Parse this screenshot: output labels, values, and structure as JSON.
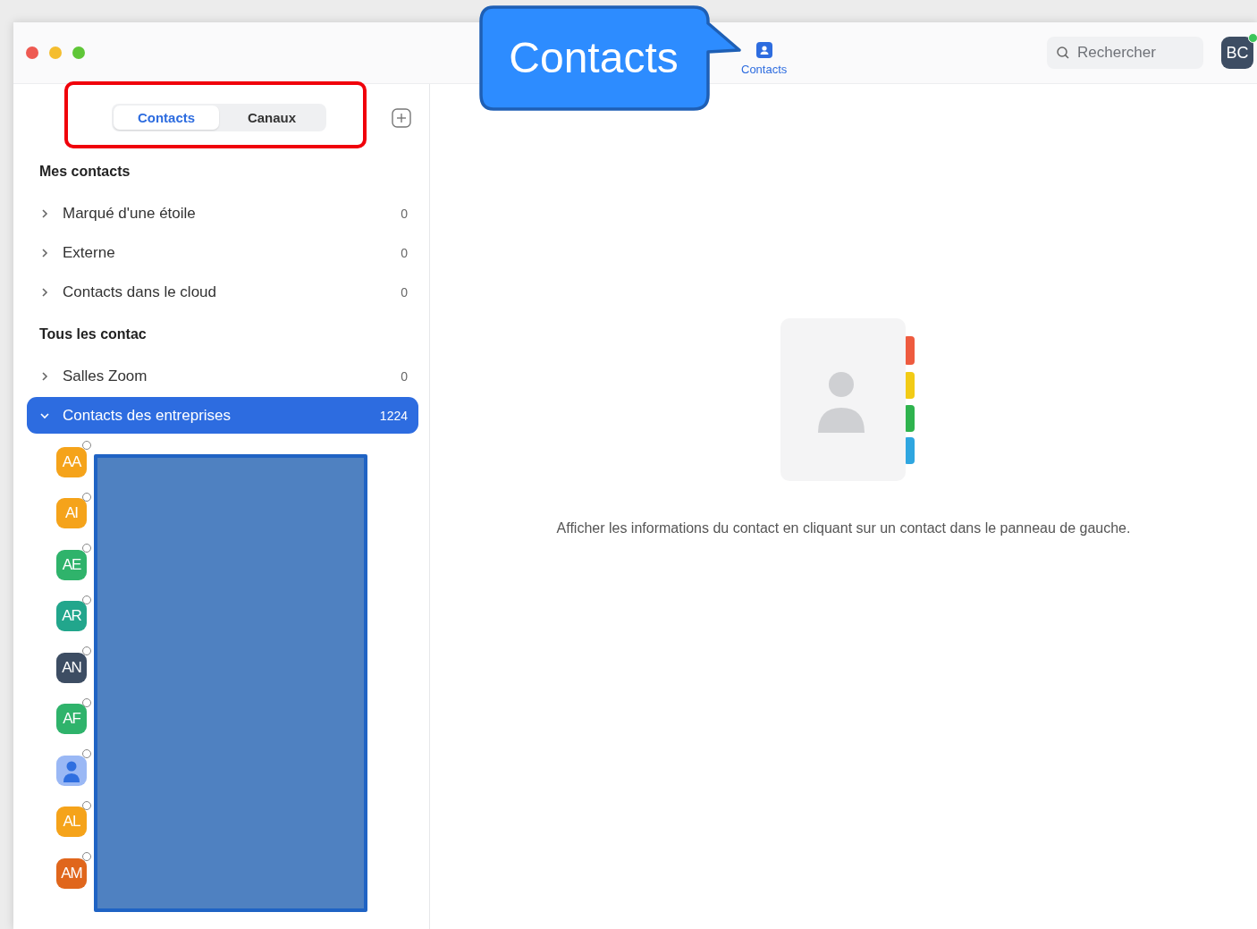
{
  "annotation": {
    "callout": "Contacts"
  },
  "top_bar": {
    "nav": [
      {
        "label": "Contacts",
        "selected": true
      }
    ],
    "search": {
      "placeholder": "Rechercher"
    },
    "avatar": {
      "initials": "BC",
      "online": true
    }
  },
  "sidebar": {
    "tabs": [
      {
        "label": "Contacts",
        "selected": true
      },
      {
        "label": "Canaux",
        "selected": false
      }
    ],
    "sections": [
      {
        "title": "Mes contacts",
        "groups": [
          {
            "label": "Marqué d'une étoile",
            "count": "0",
            "expanded": false,
            "selected": false
          },
          {
            "label": "Externe",
            "count": "0",
            "expanded": false,
            "selected": false
          },
          {
            "label": "Contacts dans le cloud",
            "count": "0",
            "expanded": false,
            "selected": false
          }
        ]
      },
      {
        "title": "Tous les contac",
        "groups": [
          {
            "label": "Salles Zoom",
            "count": "0",
            "expanded": false,
            "selected": false
          },
          {
            "label": "Contacts des entreprises",
            "count": "1224",
            "expanded": true,
            "selected": true
          }
        ]
      }
    ],
    "contacts": [
      {
        "kind": "initials",
        "initials": "AA",
        "color": "#f5a31a"
      },
      {
        "kind": "initials",
        "initials": "AI",
        "color": "#f5a31a"
      },
      {
        "kind": "initials",
        "initials": "AE",
        "color": "#2fb36b"
      },
      {
        "kind": "initials",
        "initials": "AR",
        "color": "#22a68c"
      },
      {
        "kind": "initials",
        "initials": "AN",
        "color": "#3d4d63"
      },
      {
        "kind": "initials",
        "initials": "AF",
        "color": "#2fb36b"
      },
      {
        "kind": "silhouette",
        "color": "#9ab8f5"
      },
      {
        "kind": "initials",
        "initials": "AL",
        "color": "#f5a31a"
      },
      {
        "kind": "initials",
        "initials": "AM",
        "color": "#e0661c"
      }
    ]
  },
  "detail": {
    "message": "Afficher les informations du contact en cliquant sur un contact dans le panneau de gauche."
  }
}
